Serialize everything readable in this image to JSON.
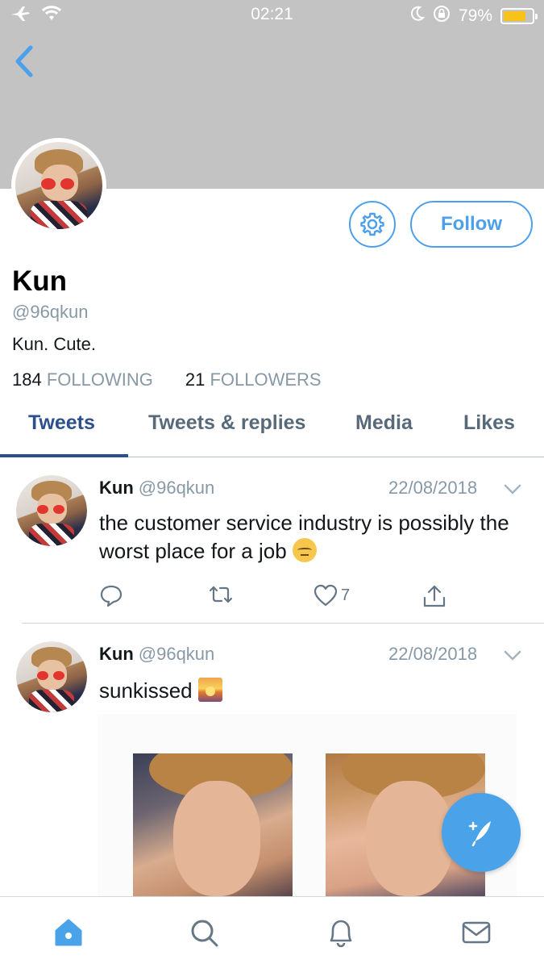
{
  "status_bar": {
    "time": "02:21",
    "battery": "79%",
    "battery_level": 0.79
  },
  "profile": {
    "name": "Kun",
    "handle": "@96qkun",
    "bio": "Kun. Cute.",
    "following_count": "184",
    "following_label": "FOLLOWING",
    "followers_count": "21",
    "followers_label": "FOLLOWERS",
    "follow_label": "Follow"
  },
  "tabs": [
    {
      "label": "Tweets",
      "active": true
    },
    {
      "label": "Tweets & replies",
      "active": false
    },
    {
      "label": "Media",
      "active": false
    },
    {
      "label": "Likes",
      "active": false
    }
  ],
  "tweets": [
    {
      "name": "Kun",
      "handle": "@96qkun",
      "date": "22/08/2018",
      "text": "the customer service industry is possibly the worst place for a job",
      "emoji": "pensive-face",
      "like_count": "7"
    },
    {
      "name": "Kun",
      "handle": "@96qkun",
      "date": "22/08/2018",
      "text": "sunkissed",
      "emoji": "sunrise"
    }
  ],
  "colors": {
    "accent": "#4ca0eb",
    "tab_active": "#2c4f8d",
    "banner": "#c3c3c3",
    "muted": "#8899a6",
    "battery": "#f7c21a"
  },
  "icons": {
    "back": "chevron-left-icon",
    "settings": "gear-icon",
    "reply": "reply-icon",
    "retweet": "retweet-icon",
    "like": "heart-icon",
    "share": "share-icon",
    "compose": "compose-icon",
    "home": "home-icon",
    "search": "search-icon",
    "notifications": "bell-icon",
    "messages": "mail-icon"
  }
}
